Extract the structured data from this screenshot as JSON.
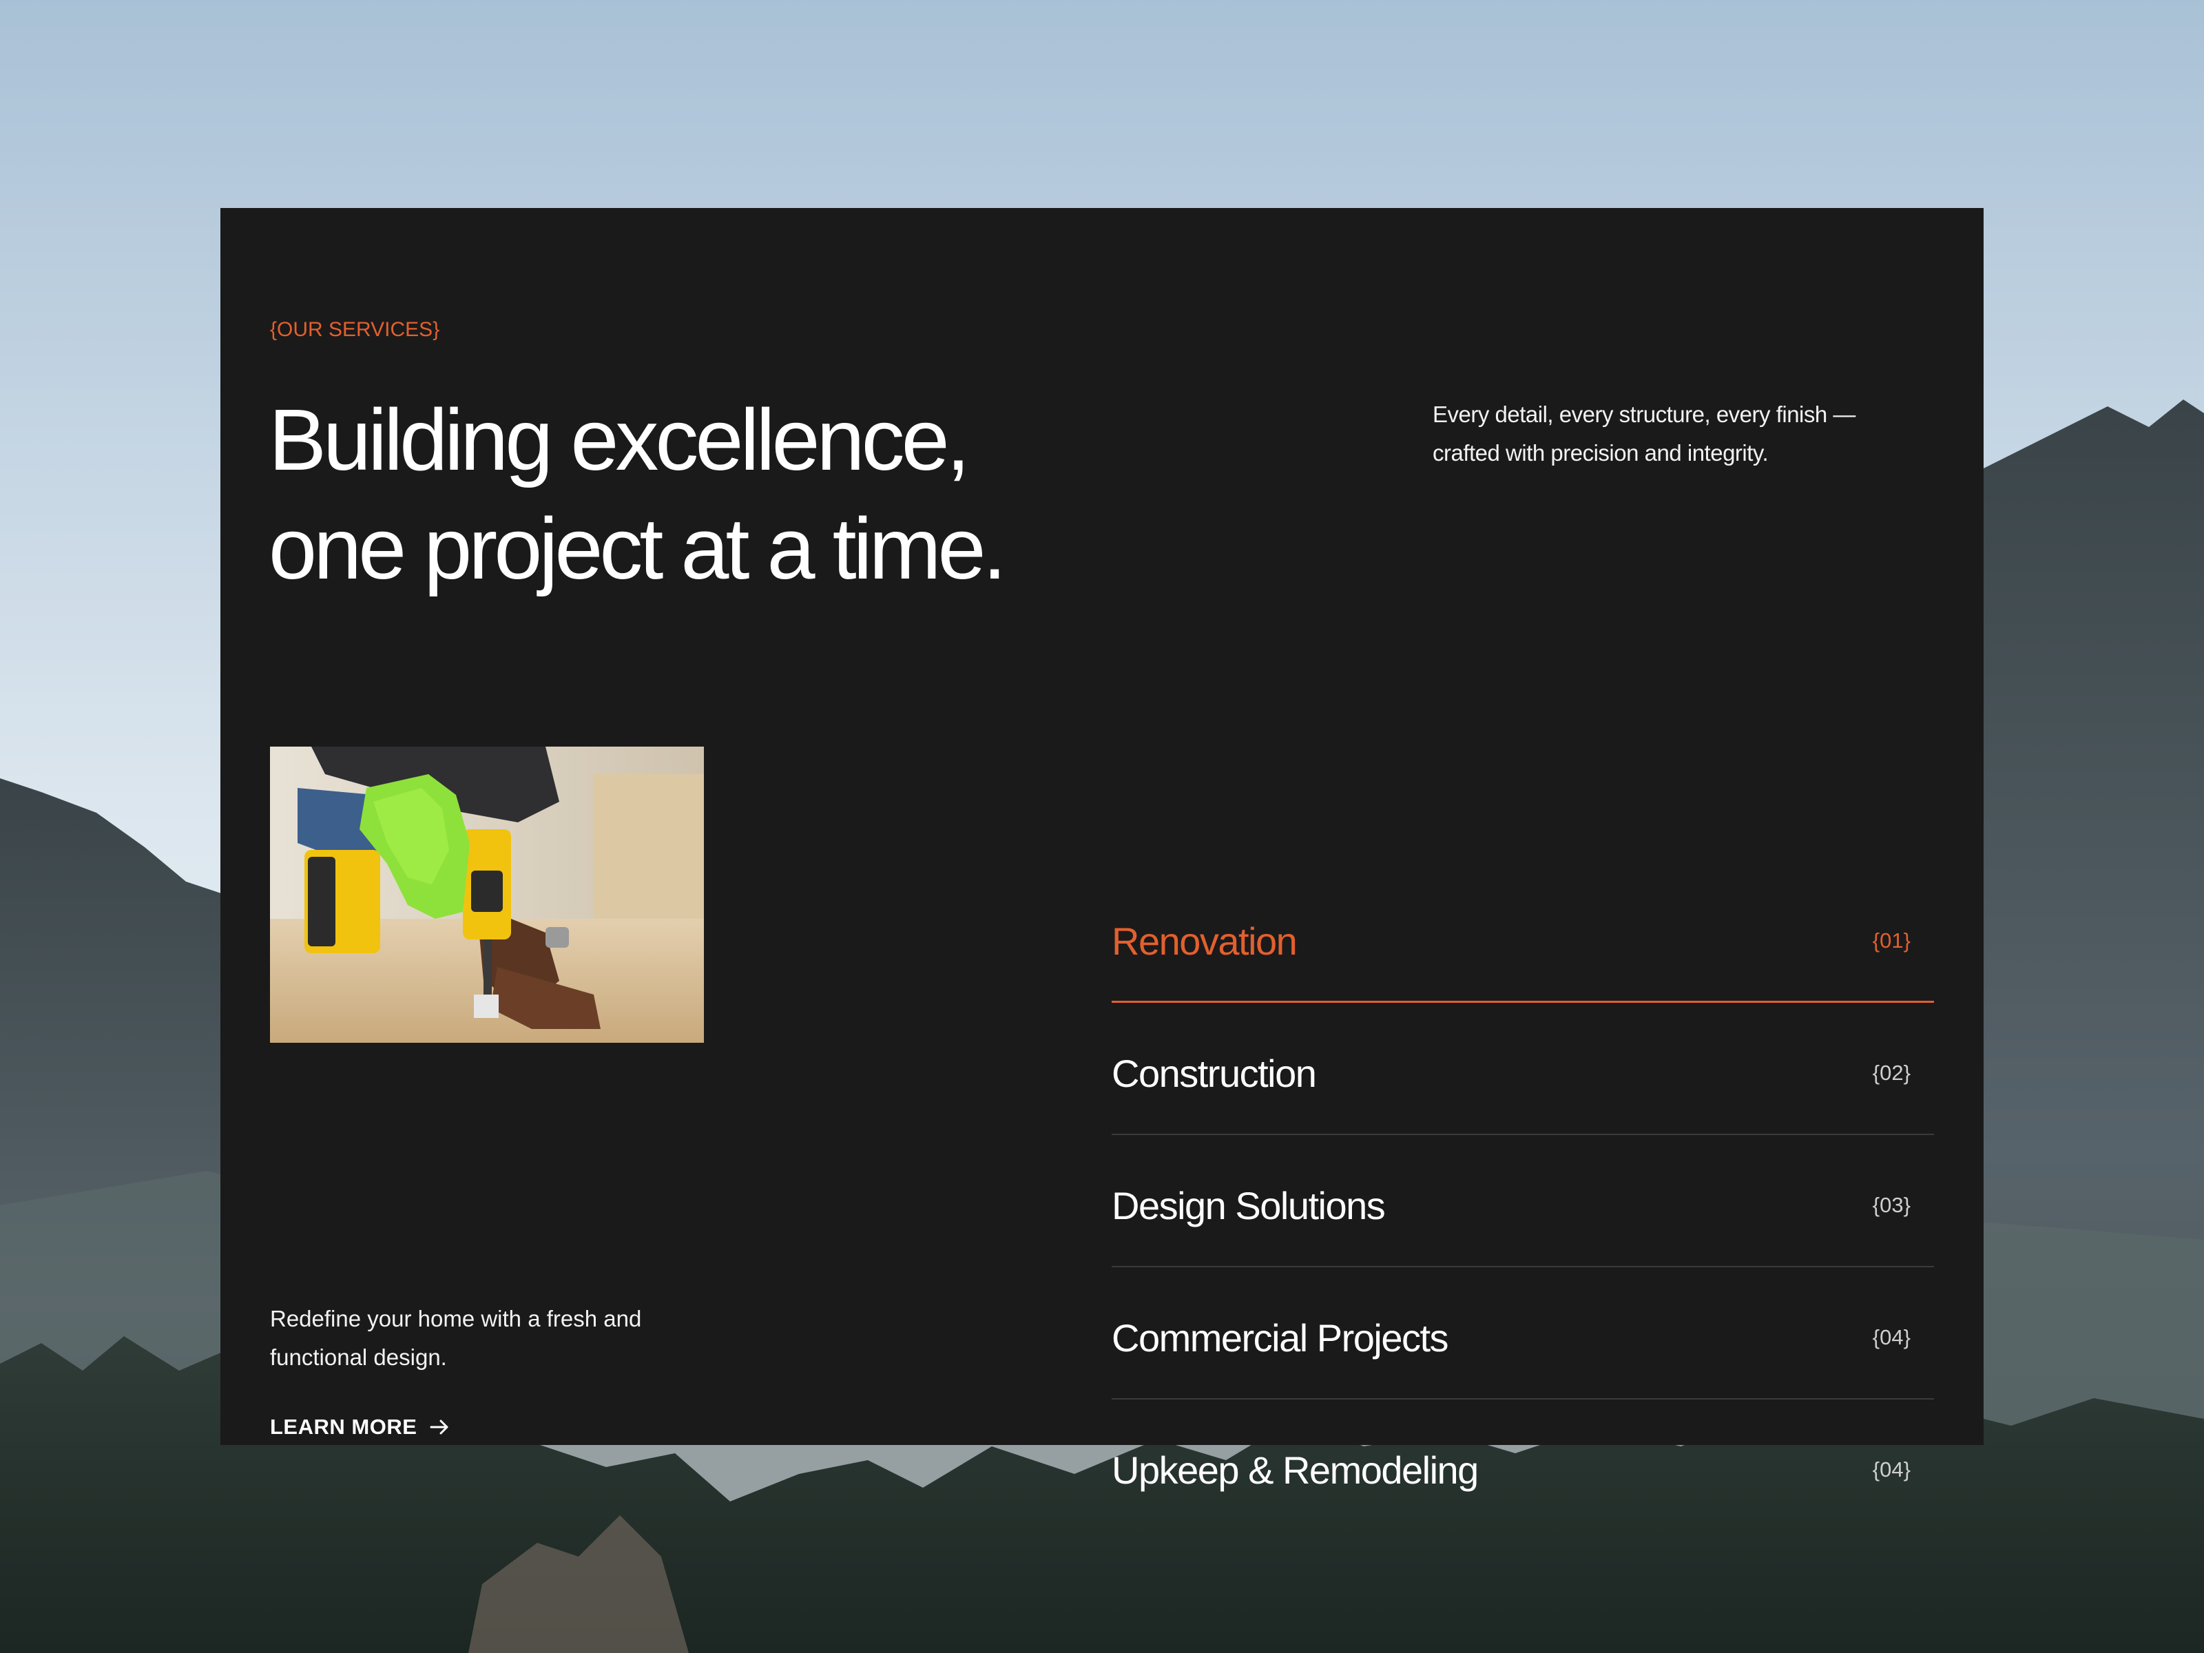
{
  "colors": {
    "accent": "#e2602d",
    "card_background": "#1a1a1b",
    "divider": "#3b3b3c",
    "text": "#ffffff"
  },
  "section": {
    "eyebrow": "{OUR SERVICES}",
    "headline_line1": "Building excellence,",
    "headline_line2": "one project at a time.",
    "intro_line1": "Every detail, every structure, every finish —",
    "intro_line2": "crafted with precision and integrity."
  },
  "feature": {
    "image_icon": "power-drill-photo",
    "blurb_line1": "Redefine your home with a fresh and",
    "blurb_line2": "functional design.",
    "cta_label": "LEARN MORE",
    "cta_icon": "arrow-right-icon"
  },
  "services": [
    {
      "name": "Renovation",
      "number": "{01}",
      "active": true
    },
    {
      "name": "Construction",
      "number": "{02}",
      "active": false
    },
    {
      "name": "Design Solutions",
      "number": "{03}",
      "active": false
    },
    {
      "name": "Commercial Projects",
      "number": "{04}",
      "active": false
    },
    {
      "name": "Upkeep & Remodeling",
      "number": "{04}",
      "active": false
    }
  ]
}
